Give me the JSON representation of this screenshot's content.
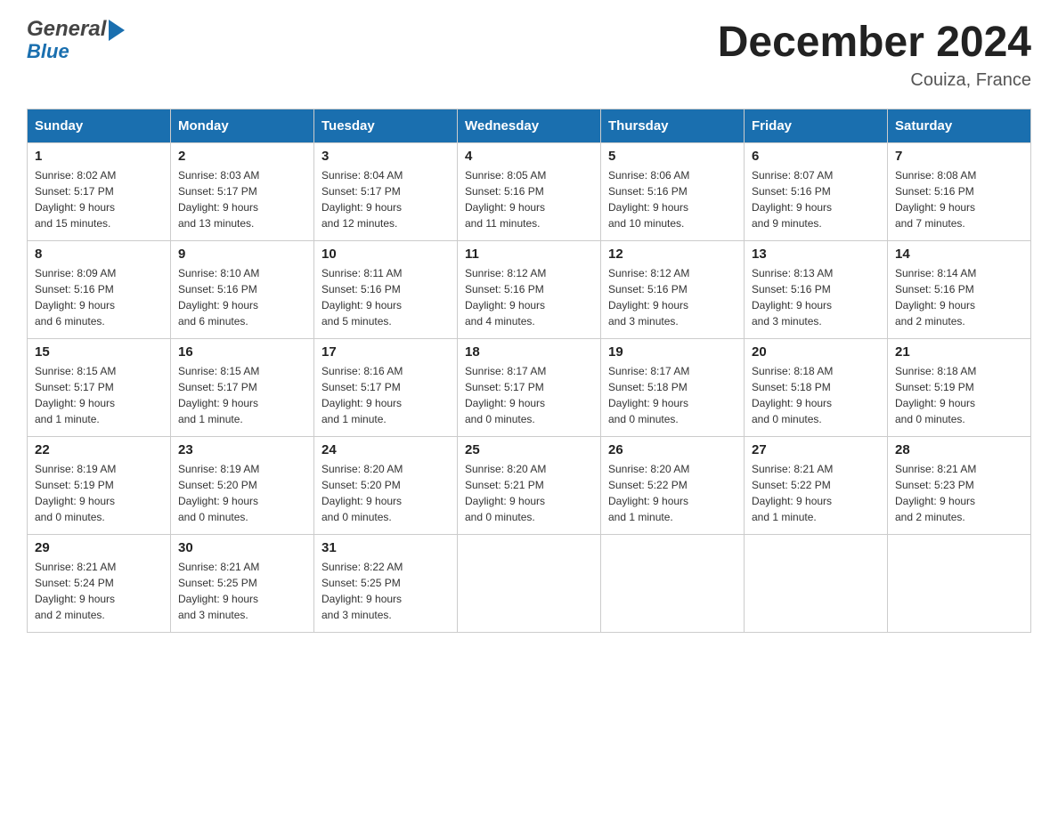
{
  "header": {
    "month_title": "December 2024",
    "location": "Couiza, France",
    "logo_general": "General",
    "logo_blue": "Blue"
  },
  "days_of_week": [
    "Sunday",
    "Monday",
    "Tuesday",
    "Wednesday",
    "Thursday",
    "Friday",
    "Saturday"
  ],
  "weeks": [
    [
      {
        "day": "1",
        "sunrise": "8:02 AM",
        "sunset": "5:17 PM",
        "daylight": "9 hours and 15 minutes."
      },
      {
        "day": "2",
        "sunrise": "8:03 AM",
        "sunset": "5:17 PM",
        "daylight": "9 hours and 13 minutes."
      },
      {
        "day": "3",
        "sunrise": "8:04 AM",
        "sunset": "5:17 PM",
        "daylight": "9 hours and 12 minutes."
      },
      {
        "day": "4",
        "sunrise": "8:05 AM",
        "sunset": "5:16 PM",
        "daylight": "9 hours and 11 minutes."
      },
      {
        "day": "5",
        "sunrise": "8:06 AM",
        "sunset": "5:16 PM",
        "daylight": "9 hours and 10 minutes."
      },
      {
        "day": "6",
        "sunrise": "8:07 AM",
        "sunset": "5:16 PM",
        "daylight": "9 hours and 9 minutes."
      },
      {
        "day": "7",
        "sunrise": "8:08 AM",
        "sunset": "5:16 PM",
        "daylight": "9 hours and 7 minutes."
      }
    ],
    [
      {
        "day": "8",
        "sunrise": "8:09 AM",
        "sunset": "5:16 PM",
        "daylight": "9 hours and 6 minutes."
      },
      {
        "day": "9",
        "sunrise": "8:10 AM",
        "sunset": "5:16 PM",
        "daylight": "9 hours and 6 minutes."
      },
      {
        "day": "10",
        "sunrise": "8:11 AM",
        "sunset": "5:16 PM",
        "daylight": "9 hours and 5 minutes."
      },
      {
        "day": "11",
        "sunrise": "8:12 AM",
        "sunset": "5:16 PM",
        "daylight": "9 hours and 4 minutes."
      },
      {
        "day": "12",
        "sunrise": "8:12 AM",
        "sunset": "5:16 PM",
        "daylight": "9 hours and 3 minutes."
      },
      {
        "day": "13",
        "sunrise": "8:13 AM",
        "sunset": "5:16 PM",
        "daylight": "9 hours and 3 minutes."
      },
      {
        "day": "14",
        "sunrise": "8:14 AM",
        "sunset": "5:16 PM",
        "daylight": "9 hours and 2 minutes."
      }
    ],
    [
      {
        "day": "15",
        "sunrise": "8:15 AM",
        "sunset": "5:17 PM",
        "daylight": "9 hours and 1 minute."
      },
      {
        "day": "16",
        "sunrise": "8:15 AM",
        "sunset": "5:17 PM",
        "daylight": "9 hours and 1 minute."
      },
      {
        "day": "17",
        "sunrise": "8:16 AM",
        "sunset": "5:17 PM",
        "daylight": "9 hours and 1 minute."
      },
      {
        "day": "18",
        "sunrise": "8:17 AM",
        "sunset": "5:17 PM",
        "daylight": "9 hours and 0 minutes."
      },
      {
        "day": "19",
        "sunrise": "8:17 AM",
        "sunset": "5:18 PM",
        "daylight": "9 hours and 0 minutes."
      },
      {
        "day": "20",
        "sunrise": "8:18 AM",
        "sunset": "5:18 PM",
        "daylight": "9 hours and 0 minutes."
      },
      {
        "day": "21",
        "sunrise": "8:18 AM",
        "sunset": "5:19 PM",
        "daylight": "9 hours and 0 minutes."
      }
    ],
    [
      {
        "day": "22",
        "sunrise": "8:19 AM",
        "sunset": "5:19 PM",
        "daylight": "9 hours and 0 minutes."
      },
      {
        "day": "23",
        "sunrise": "8:19 AM",
        "sunset": "5:20 PM",
        "daylight": "9 hours and 0 minutes."
      },
      {
        "day": "24",
        "sunrise": "8:20 AM",
        "sunset": "5:20 PM",
        "daylight": "9 hours and 0 minutes."
      },
      {
        "day": "25",
        "sunrise": "8:20 AM",
        "sunset": "5:21 PM",
        "daylight": "9 hours and 0 minutes."
      },
      {
        "day": "26",
        "sunrise": "8:20 AM",
        "sunset": "5:22 PM",
        "daylight": "9 hours and 1 minute."
      },
      {
        "day": "27",
        "sunrise": "8:21 AM",
        "sunset": "5:22 PM",
        "daylight": "9 hours and 1 minute."
      },
      {
        "day": "28",
        "sunrise": "8:21 AM",
        "sunset": "5:23 PM",
        "daylight": "9 hours and 2 minutes."
      }
    ],
    [
      {
        "day": "29",
        "sunrise": "8:21 AM",
        "sunset": "5:24 PM",
        "daylight": "9 hours and 2 minutes."
      },
      {
        "day": "30",
        "sunrise": "8:21 AM",
        "sunset": "5:25 PM",
        "daylight": "9 hours and 3 minutes."
      },
      {
        "day": "31",
        "sunrise": "8:22 AM",
        "sunset": "5:25 PM",
        "daylight": "9 hours and 3 minutes."
      },
      null,
      null,
      null,
      null
    ]
  ],
  "labels": {
    "sunrise": "Sunrise:",
    "sunset": "Sunset:",
    "daylight": "Daylight:"
  }
}
